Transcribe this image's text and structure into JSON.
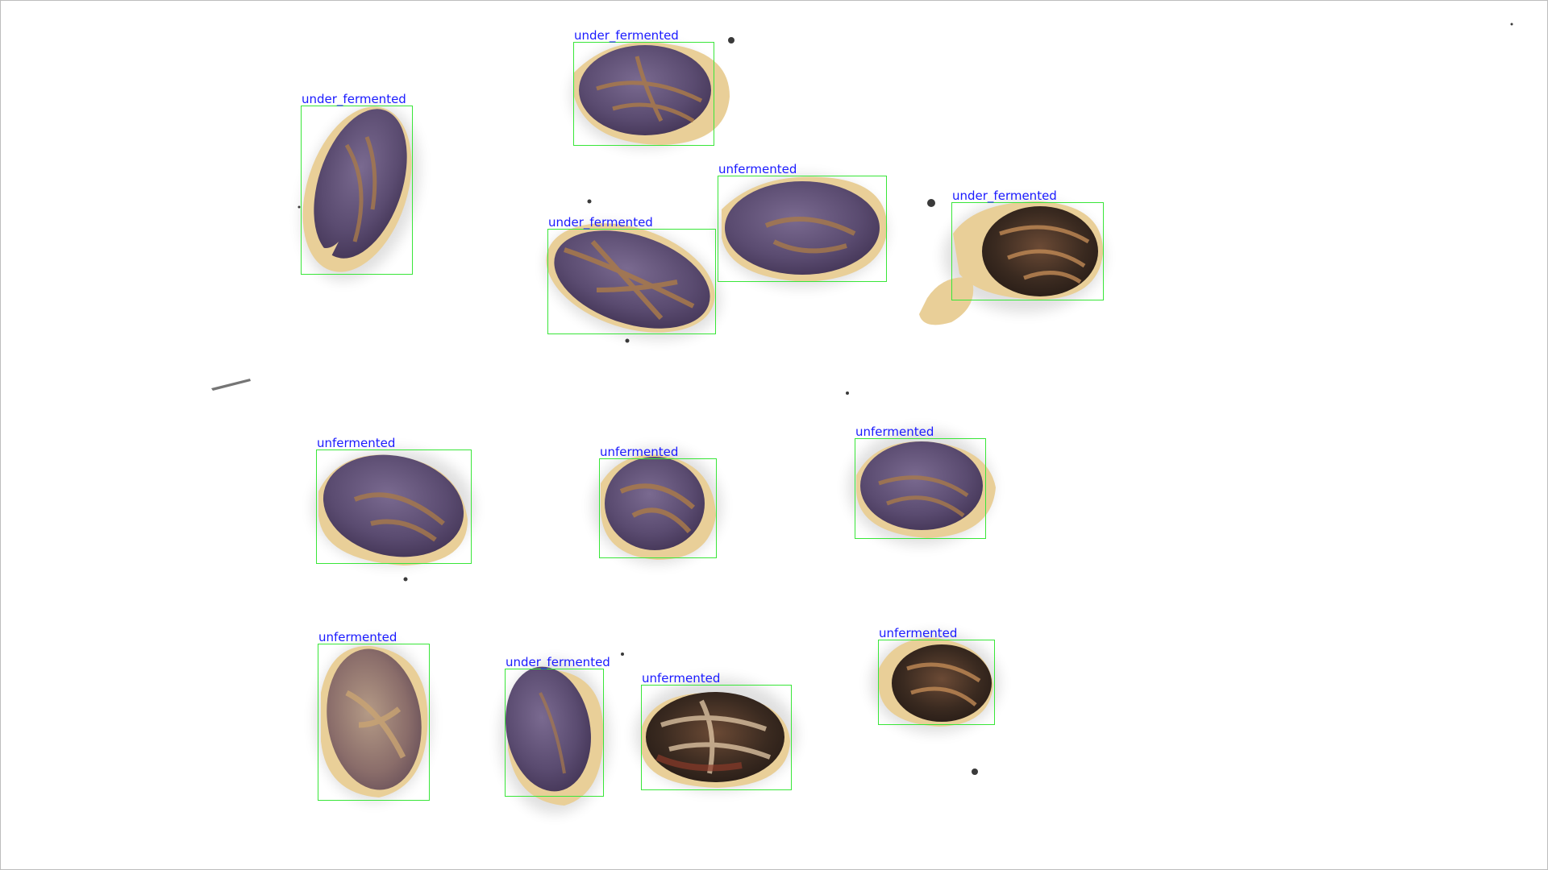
{
  "colors": {
    "background": "#ffffff",
    "box": "#39e639",
    "label": "#1a1aff",
    "bean_cotyledon_unfermented": "#5a4b70",
    "bean_cotyledon_dark": "#3a2a20",
    "bean_crack": "#b07a45",
    "bean_shell": "#e9cf98"
  },
  "detections": [
    {
      "label": "under_fermented"
    },
    {
      "label": "under_fermented"
    },
    {
      "label": "unfermented"
    },
    {
      "label": "under_fermented"
    },
    {
      "label": "under_fermented"
    },
    {
      "label": "unfermented"
    },
    {
      "label": "unfermented"
    },
    {
      "label": "unfermented"
    },
    {
      "label": "unfermented"
    },
    {
      "label": "under_fermented"
    },
    {
      "label": "unfermented"
    },
    {
      "label": "unfermented"
    }
  ]
}
